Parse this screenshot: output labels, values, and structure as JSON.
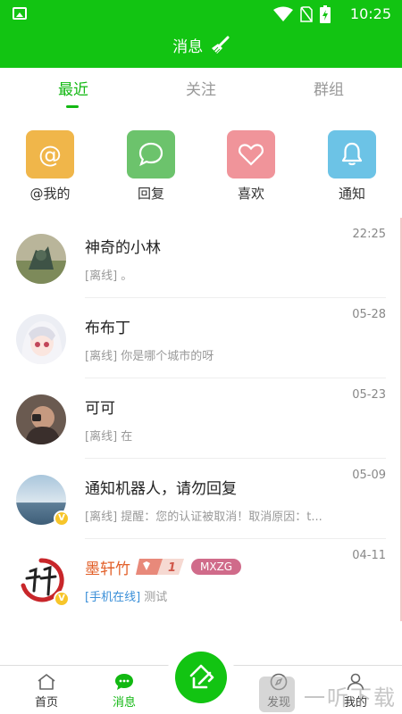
{
  "status": {
    "time": "10:25"
  },
  "header": {
    "title": "消息"
  },
  "tabs": [
    {
      "label": "最近",
      "active": true
    },
    {
      "label": "关注",
      "active": false
    },
    {
      "label": "群组",
      "active": false
    }
  ],
  "quick_actions": [
    {
      "label": "@我的",
      "icon": "at-icon",
      "color": "#f0b64a"
    },
    {
      "label": "回复",
      "icon": "chat-bubble-icon",
      "color": "#6cc36c"
    },
    {
      "label": "喜欢",
      "icon": "heart-icon",
      "color": "#f0949a"
    },
    {
      "label": "通知",
      "icon": "bell-icon",
      "color": "#6cc3e6"
    }
  ],
  "conversations": [
    {
      "name": "神奇的小林",
      "time": "22:25",
      "preview": "[离线] 。"
    },
    {
      "name": "布布丁",
      "time": "05-28",
      "preview": "[离线] 你是哪个城市的呀"
    },
    {
      "name": "可可",
      "time": "05-23",
      "preview": "[离线] 在"
    },
    {
      "name": "通知机器人，请勿回复",
      "time": "05-09",
      "preview": "[离线] 提醒：您的认证被取消！取消原因：t...",
      "verified": true
    },
    {
      "name": "墨轩竹",
      "time": "04-11",
      "status": "[手机在线]",
      "preview": "测试",
      "vip_level": "1",
      "tag": "MXZG",
      "verified": true
    }
  ],
  "bottom_nav": [
    {
      "label": "首页",
      "icon": "home-icon",
      "active": false
    },
    {
      "label": "消息",
      "icon": "message-icon",
      "active": true
    },
    {
      "label": "发现",
      "icon": "compass-icon",
      "active": false
    },
    {
      "label": "我的",
      "icon": "person-icon",
      "active": false
    }
  ],
  "watermark": {
    "text": "一听下载"
  },
  "colors": {
    "brand": "#12c412",
    "accent_text": "#12b812"
  }
}
